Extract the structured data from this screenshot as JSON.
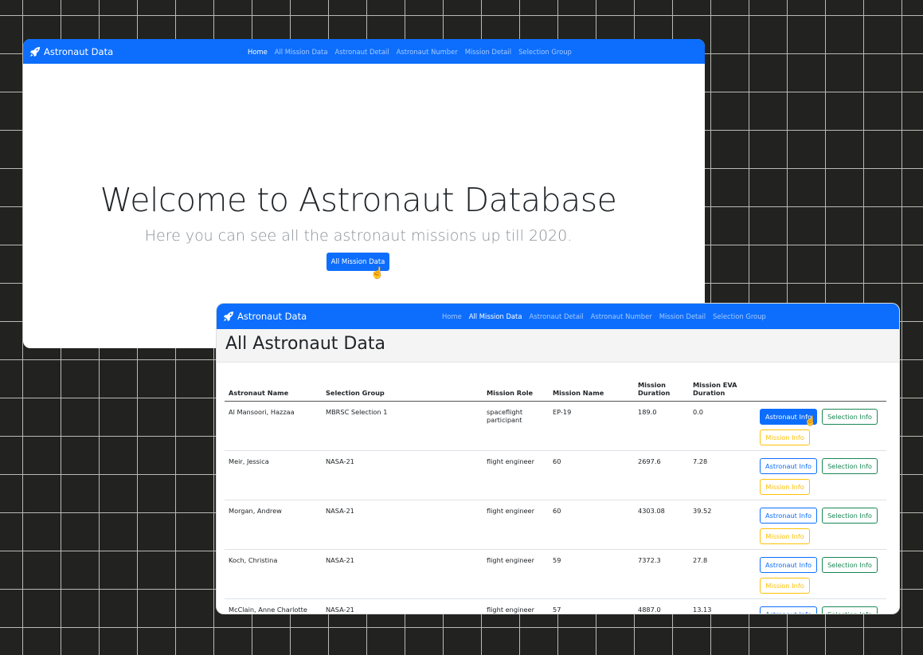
{
  "brand": "Astronaut Data",
  "nav_links": [
    "Home",
    "All Mission Data",
    "Astronaut Detail",
    "Astronaut Number",
    "Mission Detail",
    "Selection Group"
  ],
  "home": {
    "active_link": 0,
    "title": "Welcome to Astronaut Database",
    "subtitle": "Here you can see all the astronaut missions up till 2020.",
    "button": "All Mission Data"
  },
  "mission_page": {
    "active_link": 1,
    "title": "All Astronaut Data",
    "columns": [
      "Astronaut Name",
      "Selection Group",
      "Mission Role",
      "Mission Name",
      "Mission Duration",
      "Mission EVA Duration"
    ],
    "rows": [
      {
        "name": "Al Mansoori, Hazzaa",
        "group": "MBRSC Selection 1",
        "role": "spaceflight participant",
        "mission": "EP-19",
        "duration": "189.0",
        "eva": "0.0"
      },
      {
        "name": "Meir, Jessica",
        "group": "NASA-21",
        "role": "flight engineer",
        "mission": "60",
        "duration": "2697.6",
        "eva": "7.28"
      },
      {
        "name": "Morgan, Andrew",
        "group": "NASA-21",
        "role": "flight engineer",
        "mission": "60",
        "duration": "4303.08",
        "eva": "39.52"
      },
      {
        "name": "Koch, Christina",
        "group": "NASA-21",
        "role": "flight engineer",
        "mission": "59",
        "duration": "7372.3",
        "eva": "27.8"
      },
      {
        "name": "McClain, Anne Charlotte",
        "group": "NASA-21",
        "role": "flight engineer",
        "mission": "57",
        "duration": "4887.0",
        "eva": "13.13"
      }
    ],
    "buttons": {
      "astronaut": "Astronaut Info",
      "selection": "Selection Info",
      "mission": "Mission Info"
    }
  },
  "colors": {
    "primary": "#0d6efd",
    "success": "#198754",
    "warning": "#ffc107",
    "background": "#222320"
  }
}
